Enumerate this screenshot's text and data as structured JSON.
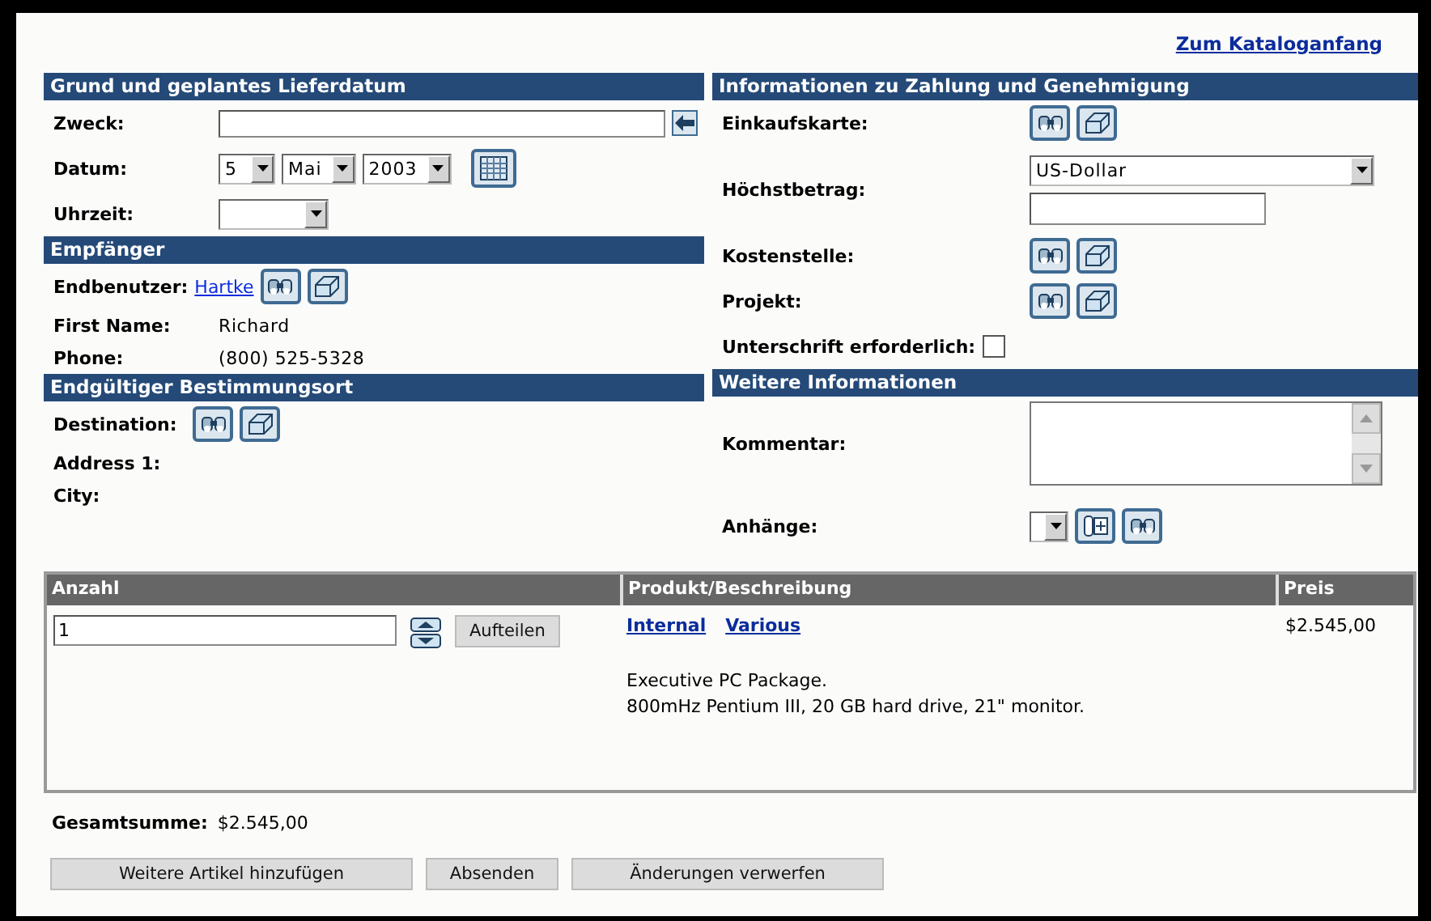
{
  "catalog_link": "Zum Kataloganfang",
  "delivery": {
    "title": "Grund und geplantes Lieferdatum",
    "purpose": {
      "label": "Zweck:"
    },
    "date": {
      "label": "Datum:",
      "day": "5",
      "month": "Mai",
      "year": "2003"
    },
    "time": {
      "label": "Uhrzeit:"
    }
  },
  "recipient": {
    "title": "Empfänger",
    "end_user": {
      "label": "Endbenutzer:",
      "link": "Hartke"
    },
    "fields": [
      {
        "label": "First Name:",
        "value": "Richard"
      },
      {
        "label": "Phone:",
        "value": "(800) 525-5328"
      }
    ]
  },
  "destination": {
    "title": "Endgültiger Bestimmungsort",
    "label": "Destination:",
    "fields": [
      {
        "label": "Address 1:"
      },
      {
        "label": "City:"
      }
    ]
  },
  "payment": {
    "title": "Informationen zu Zahlung und Genehmigung",
    "rows": [
      {
        "kind": "lookup",
        "label": "Einkaufskarte:"
      },
      {
        "kind": "amount",
        "label": "Höchstbetrag:",
        "currency": "US-Dollar"
      },
      {
        "kind": "lookup",
        "label": "Kostenstelle:"
      },
      {
        "kind": "lookup",
        "label": "Projekt:"
      },
      {
        "kind": "checkbox",
        "label": "Unterschrift erforderlich:",
        "checked": false
      }
    ]
  },
  "more_info": {
    "title": "Weitere Informationen",
    "comment_label": "Kommentar:",
    "attachments_label": "Anhänge:"
  },
  "items_table": {
    "columns": [
      "Anzahl",
      "Produkt/Beschreibung",
      "Preis"
    ],
    "rows": [
      {
        "quantity": "1",
        "split_button": "Aufteilen",
        "links": [
          "Internal",
          "Various"
        ],
        "description": [
          "Executive PC Package.",
          "800mHz Pentium III, 20 GB hard drive, 21\" monitor."
        ],
        "price": "$2.545,00"
      }
    ]
  },
  "total": {
    "label": "Gesamtsumme:",
    "value": "$2.545,00"
  },
  "buttons": [
    "Weitere Artikel hinzufügen",
    "Absenden",
    "Änderungen verwerfen"
  ]
}
